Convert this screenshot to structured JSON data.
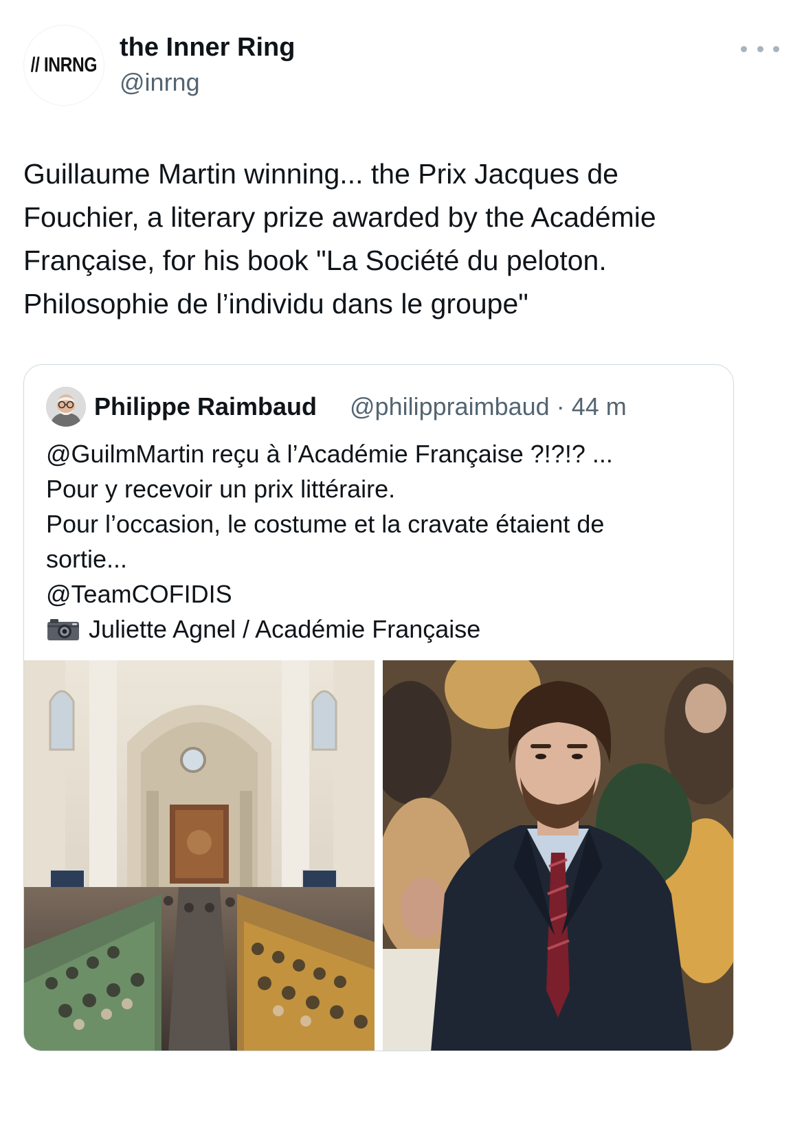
{
  "tweet": {
    "avatar_text": "// INRNG",
    "author_name": "the Inner Ring",
    "author_handle": "@inrng",
    "more_icon": "more-horizontal-icon",
    "text": "Guillaume Martin winning... the Prix Jacques de\nFouchier, a literary prize awarded by the Académie\nFrançaise, for his book \"La Société du peloton.\nPhilosophie de l’individu dans le groupe\""
  },
  "quote": {
    "author_name": "Philippe Raimbaud",
    "author_handle_time": "@philippraimbaud · 44 m",
    "text": "@GuilmMartin reçu à l’Académie Française ?!?!? ...\nPour y recevoir un prix littéraire.\nPour l’occasion, le costume et la cravate étaient de\nsortie...\n@TeamCOFIDIS",
    "credit_icon": "camera-icon",
    "credit": "Juliette Agnel / Académie Française",
    "media": [
      {
        "icon": "photo-image",
        "subject": "hall"
      },
      {
        "icon": "photo-image",
        "subject": "portrait"
      }
    ]
  },
  "colors": {
    "text": "#0f1419",
    "secondary": "#536471",
    "border": "#cfd9de"
  }
}
